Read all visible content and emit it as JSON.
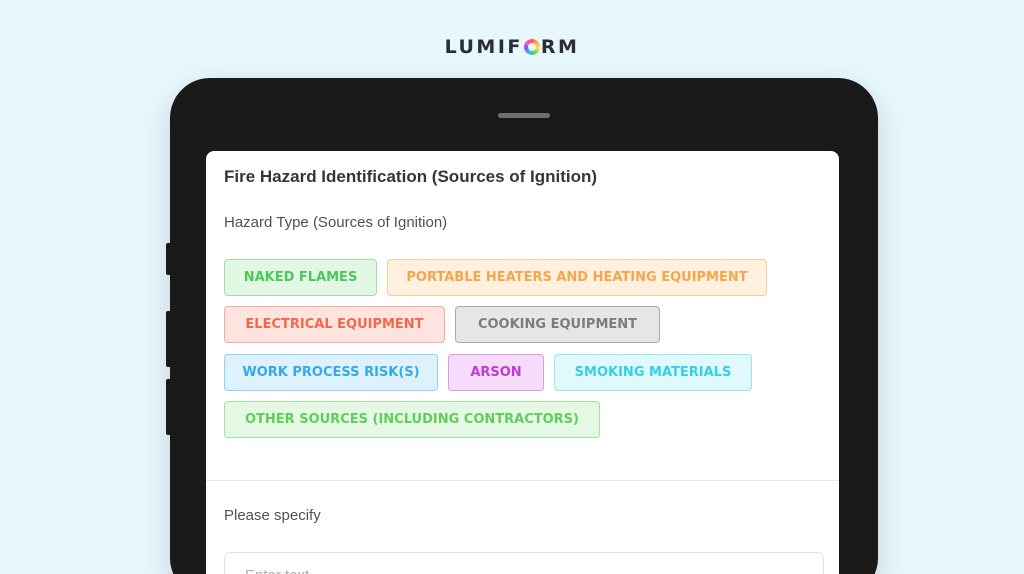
{
  "brand": {
    "logo_before": "LUMIF",
    "logo_after": "RM"
  },
  "form": {
    "title": "Fire Hazard Identification (Sources of Ignition)",
    "question_label": "Hazard Type (Sources of Ignition)",
    "options": [
      {
        "label": "NAKED FLAMES",
        "text_color": "#4cc75a",
        "bg": "#e2f8e4",
        "border": "#9fe0a6"
      },
      {
        "label": "PORTABLE HEATERS AND HEATING EQUIPMENT",
        "text_color": "#f4a74a",
        "bg": "#fff0df",
        "border": "#f7cc96"
      },
      {
        "label": "ELECTRICAL EQUIPMENT",
        "text_color": "#f0694f",
        "bg": "#fde4de",
        "border": "#f4ad9f"
      },
      {
        "label": "COOKING EQUIPMENT",
        "text_color": "#7a7d80",
        "bg": "#e6e6e6",
        "border": "#a9abad"
      },
      {
        "label": "WORK PROCESS RISK(S)",
        "text_color": "#36a9ea",
        "bg": "#def2fd",
        "border": "#90d2f4"
      },
      {
        "label": "ARSON",
        "text_color": "#c03ad6",
        "bg": "#f6dcfb",
        "border": "#dc98e9"
      },
      {
        "label": "SMOKING MATERIALS",
        "text_color": "#35cfe6",
        "bg": "#e0f9fc",
        "border": "#98e6f1"
      },
      {
        "label": "OTHER SOURCES (INCLUDING CONTRACTORS)",
        "text_color": "#5fce5a",
        "bg": "#e4f8e3",
        "border": "#a5e2a2"
      }
    ],
    "specify_label": "Please specify",
    "specify_placeholder": "Enter text"
  }
}
